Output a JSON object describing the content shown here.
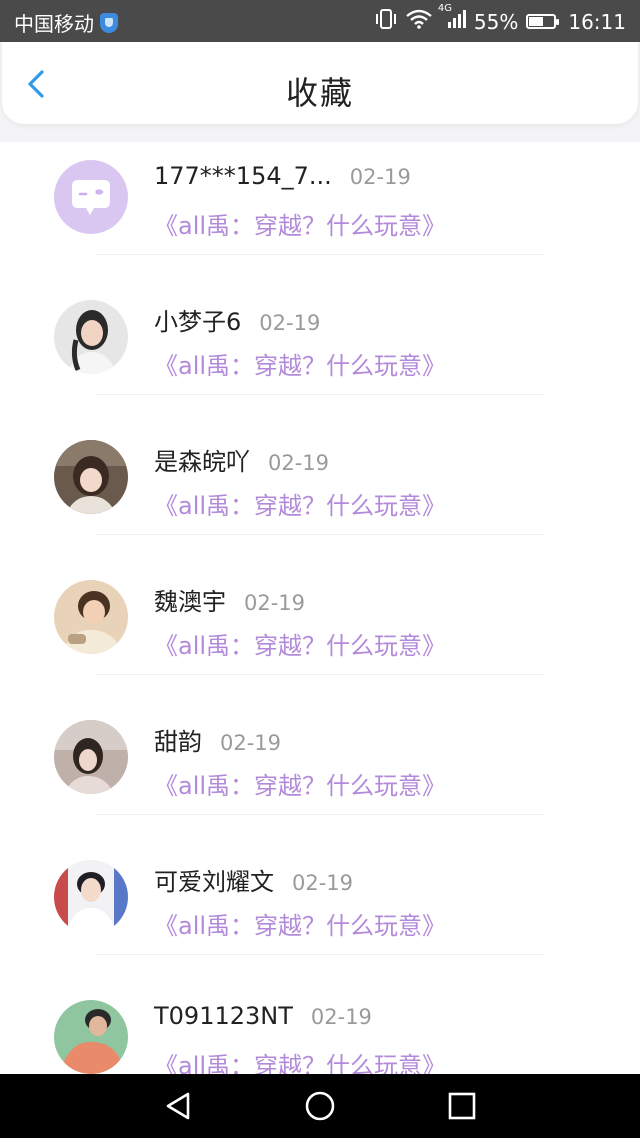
{
  "status_bar": {
    "carrier": "中国移动",
    "network": "4G",
    "battery": "55%",
    "time": "16:11",
    "icons": [
      "shield-icon",
      "vibrate-icon",
      "wifi-icon",
      "signal-icon",
      "battery-icon"
    ]
  },
  "header": {
    "title": "收藏",
    "back_icon": "chevron-left-icon"
  },
  "colors": {
    "accent": "#2f9be8",
    "title_link": "#b38ad9",
    "name": "#222222",
    "date": "#9a9a9a",
    "status_bar_bg": "#4a4a4a",
    "nav_bar_bg": "#000000",
    "default_avatar_bg": "#d9c7f2"
  },
  "favorites": [
    {
      "name": "177***154_7...",
      "date": "02-19",
      "title": "《all禹：穿越？什么玩意》",
      "avatar": "default-chat-avatar"
    },
    {
      "name": "小梦子6",
      "date": "02-19",
      "title": "《all禹：穿越？什么玩意》",
      "avatar": "user-photo-avatar"
    },
    {
      "name": "是森皖吖",
      "date": "02-19",
      "title": "《all禹：穿越？什么玩意》",
      "avatar": "user-photo-avatar"
    },
    {
      "name": "魏澳宇",
      "date": "02-19",
      "title": "《all禹：穿越？什么玩意》",
      "avatar": "user-photo-avatar"
    },
    {
      "name": "甜韵",
      "date": "02-19",
      "title": "《all禹：穿越？什么玩意》",
      "avatar": "user-photo-avatar"
    },
    {
      "name": "可爱刘耀文",
      "date": "02-19",
      "title": "《all禹：穿越？什么玩意》",
      "avatar": "user-photo-avatar"
    },
    {
      "name": "T091123NT",
      "date": "02-19",
      "title": "《all禹：穿越？什么玩意》",
      "avatar": "user-photo-avatar"
    }
  ],
  "nav_bar": {
    "buttons": [
      "back-triangle-icon",
      "home-circle-icon",
      "recents-square-icon"
    ]
  }
}
